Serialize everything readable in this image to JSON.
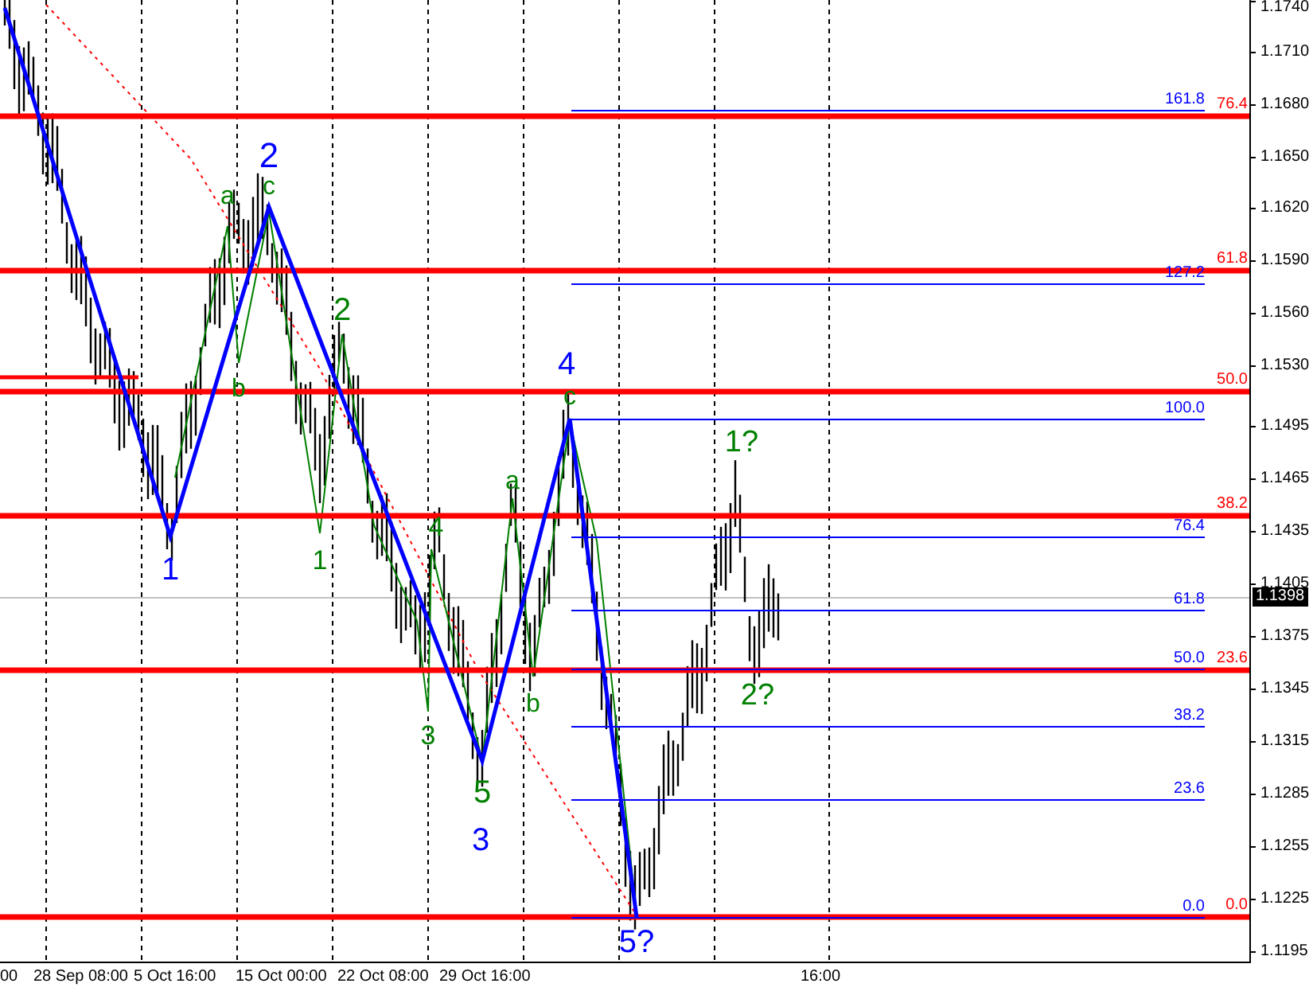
{
  "chart": {
    "price_axis": {
      "ticks": [
        "1.1740",
        "1.1710",
        "1.1680",
        "1.1650",
        "1.1620",
        "1.1590",
        "1.1560",
        "1.1530",
        "1.1495",
        "1.1465",
        "1.1435",
        "1.1405",
        "1.1375",
        "1.1345",
        "1.1315",
        "1.1285",
        "1.1255",
        "1.1225",
        "1.1195"
      ]
    },
    "time_axis": {
      "labels": [
        "00",
        "28 Sep 08:00",
        "5 Oct 16:00",
        "15 Oct 00:00",
        "22 Oct 08:00",
        "29 Oct 16:00",
        "16:00"
      ]
    },
    "current_price": "1.1398",
    "retracement_labels": [
      "76.4",
      "61.8",
      "50.0",
      "38.2",
      "23.6",
      "0.0"
    ],
    "extension_labels": [
      "161.8",
      "127.2",
      "100.0",
      "76.4",
      "61.8",
      "50.0",
      "38.2",
      "23.6",
      "0.0"
    ],
    "wave_labels": [
      {
        "text": "2",
        "color": "#0000ff"
      },
      {
        "text": "1",
        "color": "#0000ff"
      },
      {
        "text": "4",
        "color": "#0000ff"
      },
      {
        "text": "3",
        "color": "#0000ff"
      },
      {
        "text": "5?",
        "color": "#0000ff"
      },
      {
        "text": "a",
        "color": "#008000"
      },
      {
        "text": "c",
        "color": "#008000"
      },
      {
        "text": "b",
        "color": "#008000"
      },
      {
        "text": "2",
        "color": "#008000"
      },
      {
        "text": "1",
        "color": "#008000"
      },
      {
        "text": "4",
        "color": "#008000"
      },
      {
        "text": "3",
        "color": "#008000"
      },
      {
        "text": "5",
        "color": "#008000"
      },
      {
        "text": "a",
        "color": "#008000"
      },
      {
        "text": "b",
        "color": "#008000"
      },
      {
        "text": "c",
        "color": "#008000"
      },
      {
        "text": "1?",
        "color": "#008000"
      },
      {
        "text": "2?",
        "color": "#008000"
      }
    ]
  }
}
